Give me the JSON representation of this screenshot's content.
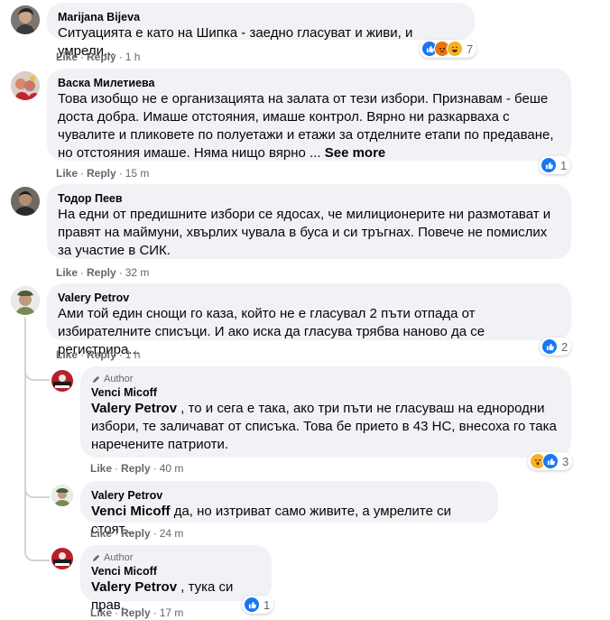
{
  "actions": {
    "like": "Like",
    "reply": "Reply",
    "separator": "·"
  },
  "author_badge": "Author",
  "colors": {
    "bubble": "#f0f2f5",
    "like_blue": "#1877f2",
    "haha_yellow": "#f7b125",
    "angry_red": "#e9710f",
    "text_secondary": "#65676b"
  },
  "comments": [
    {
      "author": "Marijana Bijeva",
      "text": "Ситуацията е като на Шипка - заедно гласуват и живи, и умрели...",
      "time": "1 h",
      "reactions": {
        "icons": [
          "like-icon",
          "angry-icon",
          "haha-icon"
        ],
        "count": "7"
      }
    },
    {
      "author": "Васка Милетиева",
      "text": "Това изобщо не е организацията на залата от тези избори. Признавам - беше доста добра. Имаше отстояния, имаше контрол. Вярно ни разкарваха с чувалите и пликовете по полуетажи и етажи за отделните етапи по предаване, но отстояния имаше. Няма нищо вярно ...",
      "see_more": "See more",
      "time": "15 m",
      "reactions": {
        "icons": [
          "like-icon"
        ],
        "count": "1"
      }
    },
    {
      "author": "Тодор Пеев",
      "text": "На едни от предишните избори се ядосах, че милиционерите ни размотават и правят на маймуни, хвърлих чувала в буса и си тръгнах. Повече не помислих за участие в СИК.",
      "time": "32 m"
    },
    {
      "author": "Valery Petrov",
      "text": "Ами той един снощи го каза, който не е гласувал 2 пъти отпада от избирателните списъци. И ако иска да гласува трябва наново да се регистрира...",
      "time": "1 h",
      "reactions": {
        "icons": [
          "like-icon"
        ],
        "count": "2"
      }
    }
  ],
  "replies": [
    {
      "author": "Venci Micoff",
      "is_author": true,
      "mention": "Valery Petrov",
      "text": " , то и сега е така, ако три пъти не гласуваш на еднородни избори, те заличават от списъка. Това бе прието в 43 НС, внесоха го така наречените патриоти.",
      "time": "40 m",
      "reactions": {
        "icons": [
          "wow-icon",
          "like-icon"
        ],
        "count": "3"
      }
    },
    {
      "author": "Valery Petrov",
      "is_author": false,
      "mention": "Venci Micoff",
      "text": " да, но изтриват само живите, а умрелите си стоят...",
      "time": "24 m"
    },
    {
      "author": "Venci Micoff",
      "is_author": true,
      "mention": "Valery Petrov",
      "text": " , тука си прав.",
      "time": "17 m",
      "reactions": {
        "icons": [
          "like-icon"
        ],
        "count": "1"
      }
    }
  ]
}
